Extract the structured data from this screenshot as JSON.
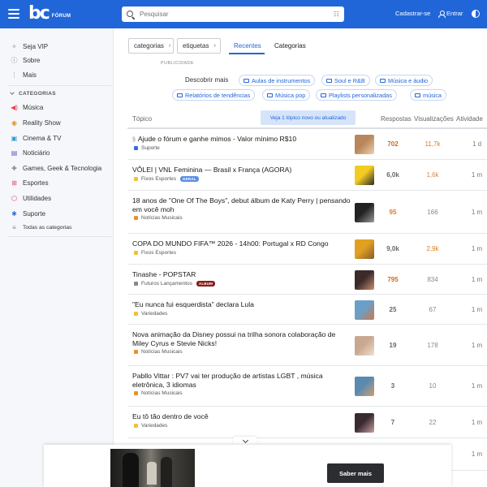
{
  "header": {
    "logo_mark": "bc",
    "logo_text": "FÓRUM",
    "search_placeholder": "Pesquisar",
    "signup_label": "Cadastrar-se",
    "login_label": "Entrar"
  },
  "sidebar": {
    "top_items": [
      {
        "label": "Seja VIP",
        "icon": "sparkle-icon"
      },
      {
        "label": "Sobre",
        "icon": "info-icon"
      },
      {
        "label": "Mais",
        "icon": "more-icon"
      }
    ],
    "section_label": "CATEGORIAS",
    "categories": [
      {
        "label": "Música",
        "icon": "speaker-icon",
        "color": "#e04848"
      },
      {
        "label": "Reality Show",
        "icon": "eye-icon",
        "color": "#e8912c"
      },
      {
        "label": "Cinema & TV",
        "icon": "film-icon",
        "color": "#2f9ad6"
      },
      {
        "label": "Noticiário",
        "icon": "news-icon",
        "color": "#6a5acd"
      },
      {
        "label": "Games, Geek & Tecnologia",
        "icon": "gamepad-icon",
        "color": "#888888"
      },
      {
        "label": "Esportes",
        "icon": "grid-icon",
        "color": "#d84a6a"
      },
      {
        "label": "Utilidades",
        "icon": "shield-icon",
        "color": "#d63a5c"
      },
      {
        "label": "Suporte",
        "icon": "support-icon",
        "color": "#2f6fd6"
      }
    ],
    "all_categories_label": "Todas as categorias"
  },
  "main": {
    "categories_dropdown": "categorias",
    "tags_dropdown": "etiquetas",
    "tabs": [
      {
        "label": "Recentes",
        "active": true
      },
      {
        "label": "Categorias",
        "active": false
      }
    ],
    "publicidade": "PUBLICIDADE",
    "discover_label": "Descobrir mais",
    "chips": [
      "Aulas de instrumentos",
      "Soul e R&B",
      "Música e áudio",
      "Relatórios de tendências",
      "Música pop",
      "Playlists personalizadas",
      "música"
    ],
    "new_topic_button": "Veja 1 tópico novo ou atualizado",
    "columns": {
      "topic": "Tópico",
      "replies": "Respostas",
      "views": "Visualizações",
      "activity": "Atividade"
    },
    "topics": [
      {
        "title": "Ajude o fórum e ganhe mimos - Valor mínimo R$10",
        "pinned": true,
        "category": "Suporte",
        "category_color": "#2f6fd6",
        "tag": "",
        "replies": "702",
        "replies_color": "#d2691e",
        "views": "11,7k",
        "views_color": "#e07b1f",
        "activity": "1 d",
        "avatar_colors": [
          "#b8865a",
          "#f0d0b0"
        ]
      },
      {
        "title": "VÔLEI | VNL Feminina — Brasil x França (AGORA)",
        "pinned": false,
        "category": "Fixos Esportes",
        "category_color": "#f2c230",
        "tag": "GERAL",
        "tag_color": "#5b8fe6",
        "replies": "6,0k",
        "replies_color": "#666666",
        "views": "1,6k",
        "views_color": "#c78b55",
        "activity": "1 m",
        "avatar_colors": [
          "#f2cc22",
          "#2a2a2a"
        ]
      },
      {
        "title": "18 anos de \"One Of The Boys\", debut álbum de Katy Perry | pensando em você moh",
        "pinned": false,
        "category": "Notícias Musicais",
        "category_color": "#e8912c",
        "tag": "",
        "replies": "95",
        "replies_color": "#e07b1f",
        "views": "166",
        "views_color": "#888888",
        "activity": "1 m",
        "avatar_colors": [
          "#222222",
          "#9a9a9a"
        ]
      },
      {
        "title": "COPA DO MUNDO FIFA™ 2026 - 14h00: Portugal x RD Congo",
        "pinned": false,
        "category": "Fixos Esportes",
        "category_color": "#f2c230",
        "tag": "",
        "replies": "9,0k",
        "replies_color": "#666666",
        "views": "2,9k",
        "views_color": "#e07b1f",
        "activity": "1 m",
        "avatar_colors": [
          "#e0a020",
          "#8a5a30"
        ]
      },
      {
        "title": "Tinashe - POPSTAR",
        "pinned": false,
        "category": "Futuros Lançamentos",
        "category_color": "#888888",
        "tag": "ALBUM",
        "tag_color": "#8b1a1a",
        "replies": "795",
        "replies_color": "#d2691e",
        "views": "834",
        "views_color": "#888888",
        "activity": "1 m",
        "avatar_colors": [
          "#3a2a2a",
          "#c89070"
        ]
      },
      {
        "title": "\"Eu nunca fui esquerdista\" declara Lula",
        "pinned": false,
        "category": "Variedades",
        "category_color": "#f2c230",
        "tag": "",
        "replies": "25",
        "replies_color": "#666666",
        "views": "67",
        "views_color": "#888888",
        "activity": "1 m",
        "avatar_colors": [
          "#6aa0c8",
          "#c87850"
        ]
      },
      {
        "title": "Nova animação da Disney possui na trilha sonora colaboração de Miley Cyrus e Stevie Nicks!",
        "pinned": false,
        "category": "Notícias Musicais",
        "category_color": "#e8912c",
        "tag": "",
        "replies": "19",
        "replies_color": "#666666",
        "views": "178",
        "views_color": "#888888",
        "activity": "1 m",
        "avatar_colors": [
          "#c8a890",
          "#f0e0d0"
        ]
      },
      {
        "title": "Pabllo Vittar : PV7 vai ter produção de artistas LGBT , música eletrônica, 3 idiomas",
        "pinned": false,
        "category": "Notícias Musicais",
        "category_color": "#e8912c",
        "tag": "",
        "replies": "3",
        "replies_color": "#666666",
        "views": "10",
        "views_color": "#888888",
        "activity": "1 m",
        "avatar_colors": [
          "#5a8ab0",
          "#d0a070"
        ]
      },
      {
        "title": "Eu tô tão dentro de você",
        "pinned": false,
        "category": "Variedades",
        "category_color": "#f2c230",
        "tag": "",
        "replies": "7",
        "replies_color": "#666666",
        "views": "22",
        "views_color": "#888888",
        "activity": "1 m",
        "avatar_colors": [
          "#3a2a30",
          "#c8a0a0"
        ]
      },
      {
        "title": "",
        "pinned": false,
        "category": "",
        "category_color": "#ffffff",
        "tag": "",
        "replies": "",
        "replies_color": "#666666",
        "views": "",
        "views_color": "#888888",
        "activity": "1 m",
        "avatar_colors": [
          "#ffffff",
          "#ffffff"
        ]
      }
    ]
  },
  "ad": {
    "button_label": "Saber mais"
  }
}
